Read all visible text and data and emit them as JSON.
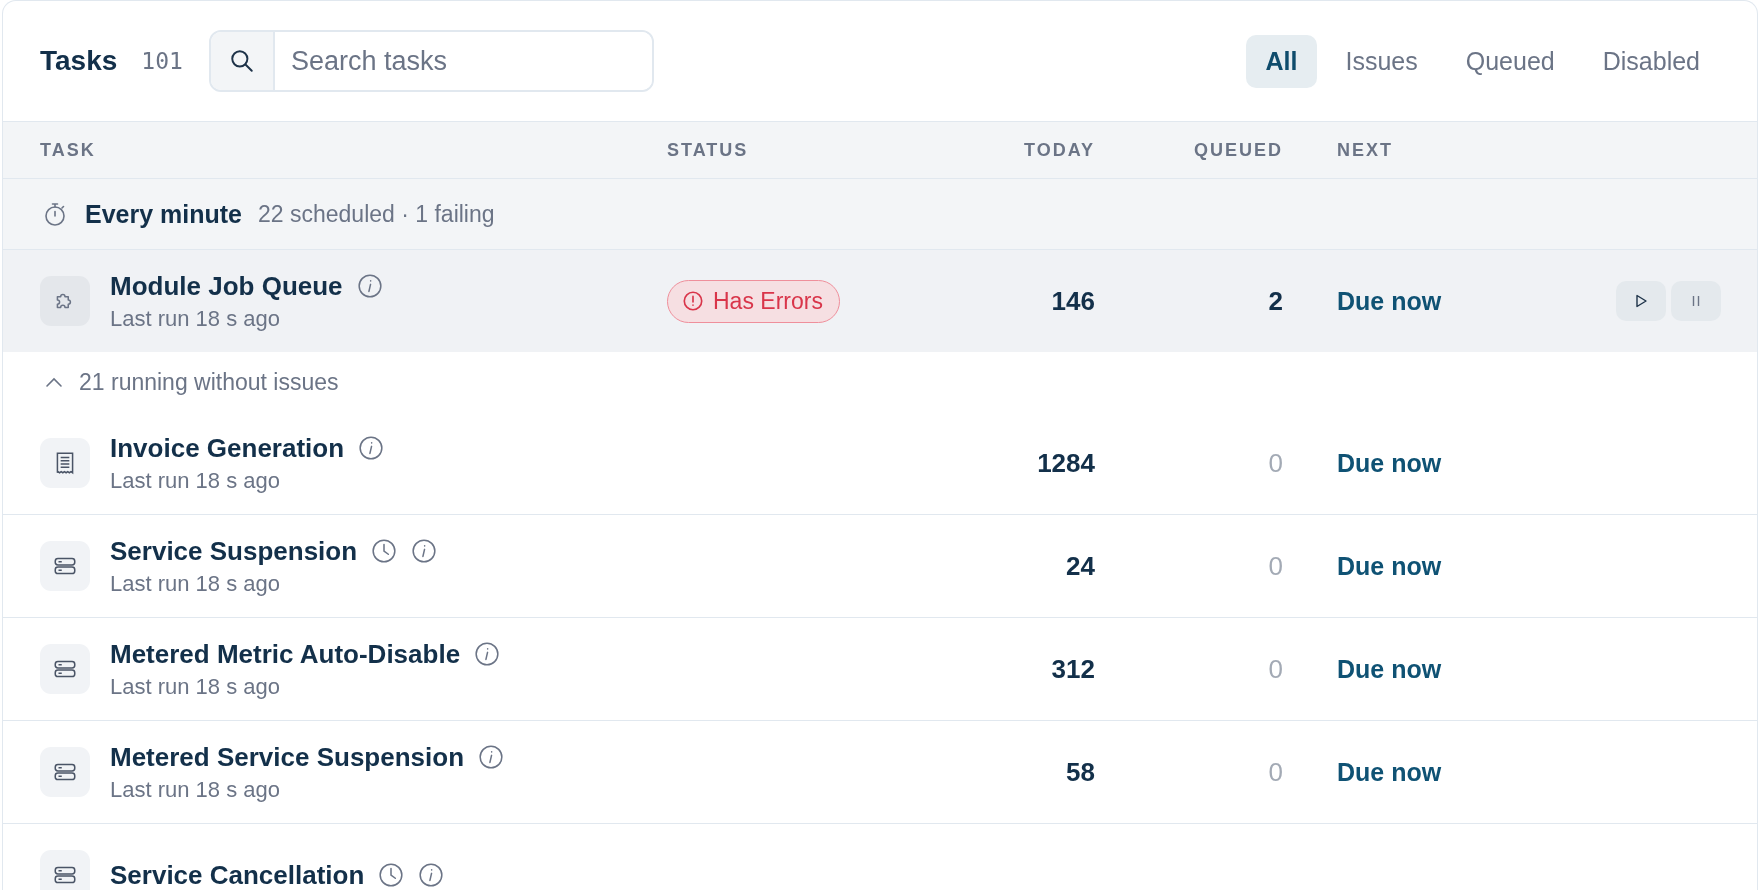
{
  "header": {
    "title": "Tasks",
    "count": "101",
    "search": {
      "placeholder": "Search tasks"
    },
    "tabs": [
      {
        "label": "All",
        "selected": true
      },
      {
        "label": "Issues",
        "selected": false
      },
      {
        "label": "Queued",
        "selected": false
      },
      {
        "label": "Disabled",
        "selected": false
      }
    ]
  },
  "table": {
    "columns": [
      "TASK",
      "STATUS",
      "TODAY",
      "QUEUED",
      "NEXT"
    ],
    "group": {
      "title": "Every minute",
      "summary": "22 scheduled · 1 failing"
    },
    "issue_rows": [
      {
        "kind": "puzzle",
        "name": "Module Job Queue",
        "clock": false,
        "last_run": "Last run 18 s ago",
        "status": "Has Errors",
        "today": "146",
        "queued": "2",
        "queued_muted": false,
        "next": "Due now",
        "selected": true
      }
    ],
    "collapse": {
      "label": "21 running without issues",
      "expanded": true
    },
    "rows": [
      {
        "kind": "receipt",
        "name": "Invoice Generation",
        "clock": false,
        "last_run": "Last run 18 s ago",
        "today": "1284",
        "queued": "0",
        "queued_muted": true,
        "next": "Due now",
        "selected": false
      },
      {
        "kind": "server",
        "name": "Service Suspension",
        "clock": true,
        "last_run": "Last run 18 s ago",
        "today": "24",
        "queued": "0",
        "queued_muted": true,
        "next": "Due now",
        "selected": false
      },
      {
        "kind": "server",
        "name": "Metered Metric Auto-Disable",
        "clock": false,
        "last_run": "Last run 18 s ago",
        "today": "312",
        "queued": "0",
        "queued_muted": true,
        "next": "Due now",
        "selected": false
      },
      {
        "kind": "server",
        "name": "Metered Service Suspension",
        "clock": false,
        "last_run": "Last run 18 s ago",
        "today": "58",
        "queued": "0",
        "queued_muted": true,
        "next": "Due now",
        "selected": false
      },
      {
        "kind": "server",
        "name": "Service Cancellation",
        "clock": true,
        "selected": false
      }
    ]
  }
}
